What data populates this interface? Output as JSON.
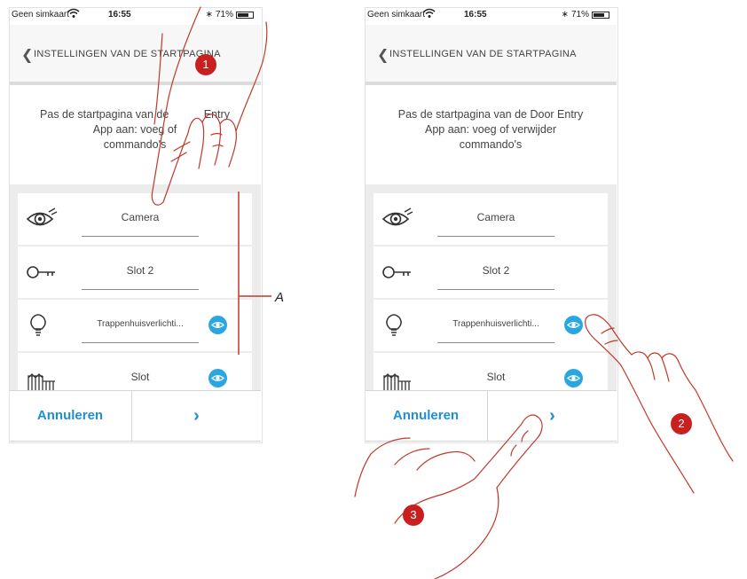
{
  "status_bar": {
    "carrier": "Geen simkaart",
    "time": "16:55",
    "battery": "71%"
  },
  "header": {
    "title": "INSTELLINGEN VAN DE STARTPAGINA"
  },
  "description": {
    "left": [
      "Pas de startpagina van de",
      "Entry",
      "App aan: voeg of",
      "commando's"
    ],
    "right": [
      "Pas de startpagina van de Door Entry",
      "App aan: voeg of verwijder",
      "commando's"
    ]
  },
  "commands": [
    {
      "label": "Camera",
      "icon": "eye-icon",
      "visibility_button": false
    },
    {
      "label": "Slot 2",
      "icon": "key-icon",
      "visibility_button": false
    },
    {
      "label": "Trappenhuisverlichti...",
      "icon": "light-bulb-icon",
      "visibility_button": true
    },
    {
      "label": "Slot",
      "icon": "gate-icon",
      "visibility_button": true
    }
  ],
  "footer": {
    "cancel_label": "Annuleren",
    "next_label": "›"
  },
  "annotations": {
    "bracket_label": "A",
    "step1": "1",
    "step2": "2",
    "step3": "3"
  },
  "colors": {
    "accent": "#2aa7e0",
    "link": "#1e8fd6",
    "step_badge": "#c8201e",
    "hand_outline": "#c0392b"
  }
}
